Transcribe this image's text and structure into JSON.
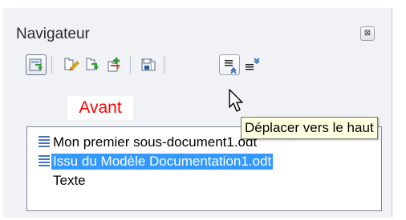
{
  "navigator": {
    "title": "Navigateur",
    "close_icon": "close-icon",
    "toolbar": [
      {
        "name": "toggle-master-view-icon",
        "state": "pressed"
      },
      {
        "name": "edit-icon"
      },
      {
        "name": "update-icon"
      },
      {
        "name": "insert-icon"
      },
      {
        "name": "save-contents-icon"
      },
      {
        "name": "move-up-icon",
        "state": "hover"
      },
      {
        "name": "move-down-icon"
      }
    ],
    "annotation_label": "Avant",
    "items": [
      {
        "label": "Mon premier sous-document1.odt",
        "icon": "document-icon",
        "selected": false
      },
      {
        "label": "Issu du Modèle Documentation1.odt",
        "icon": "document-icon",
        "selected": true
      },
      {
        "label": "Texte",
        "icon": "",
        "selected": false
      }
    ],
    "tooltip": "Déplacer vers le haut"
  },
  "colors": {
    "selection": "#3399ff",
    "annotation": "#ff0000",
    "tooltip_bg": "#ffffe1",
    "panel_bg": "#f0f2f6"
  }
}
